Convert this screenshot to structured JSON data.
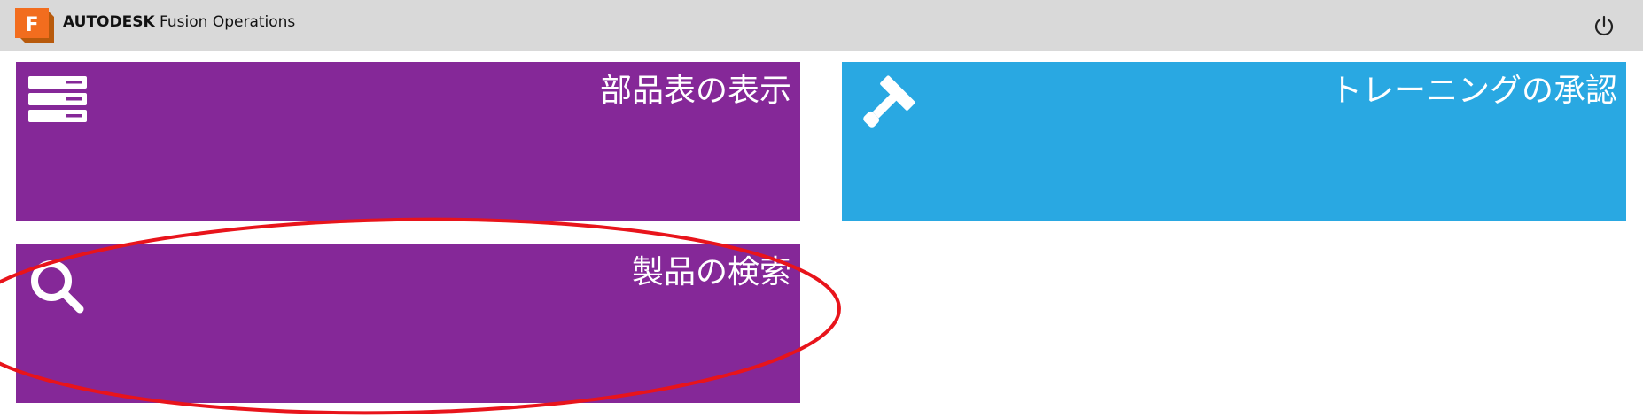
{
  "header": {
    "brand_bold": "AUTODESK",
    "brand_product": "Fusion Operations",
    "logo_letter": "F",
    "logo_icon": "fusion-logo-icon",
    "power_icon": "power-icon"
  },
  "tiles": [
    {
      "label": "部品表の表示",
      "icon": "list-icon",
      "color": "#852898"
    },
    {
      "label": "トレーニングの承認",
      "icon": "gavel-icon",
      "color": "#29a8e2"
    },
    {
      "label": "製品の検索",
      "icon": "search-icon",
      "color": "#852898"
    }
  ],
  "colors": {
    "header_bg": "#d9d9d9",
    "annotation": "#e8141b"
  }
}
